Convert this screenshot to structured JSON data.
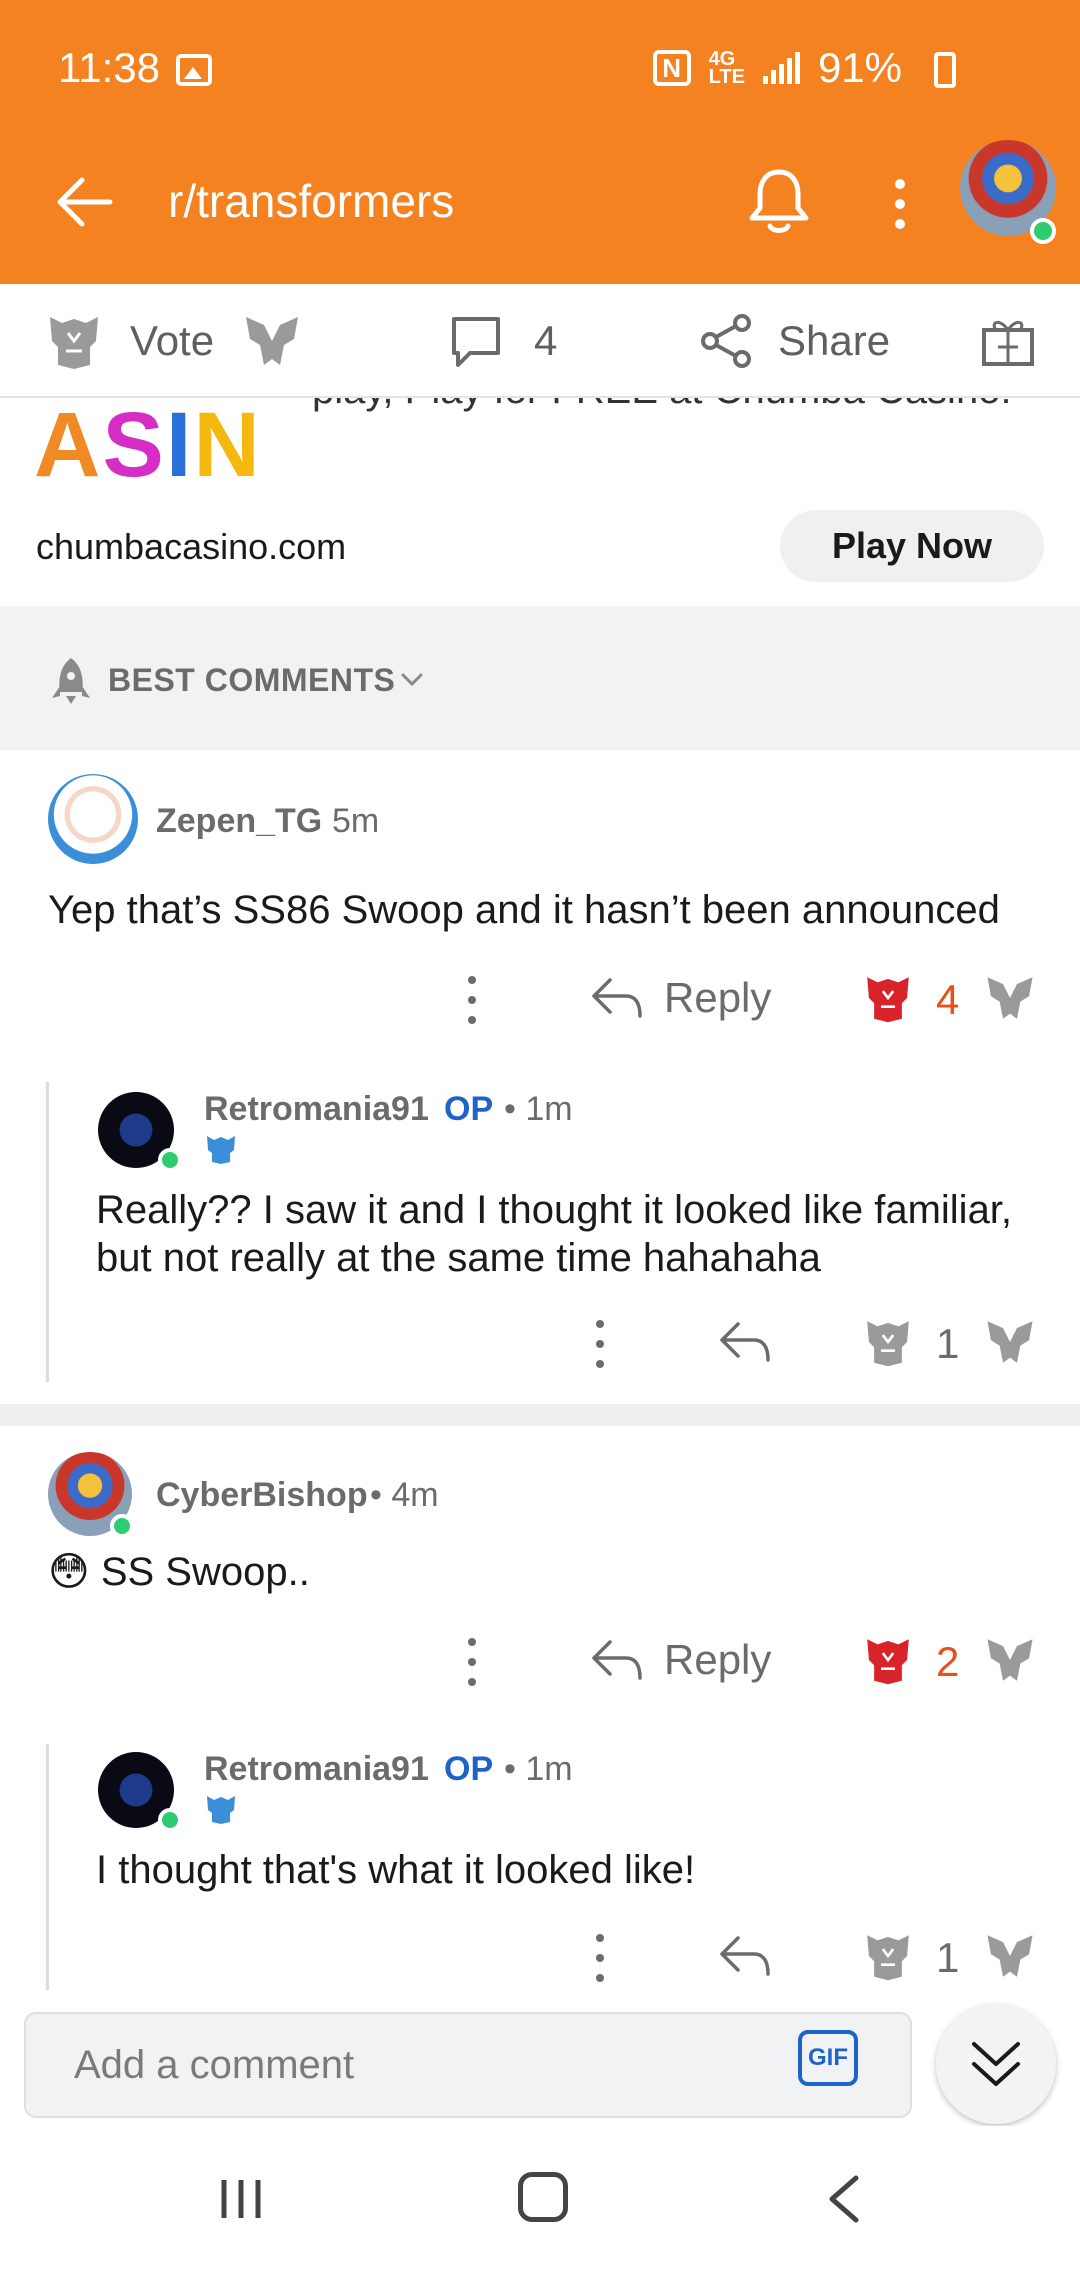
{
  "status_bar": {
    "time": "11:38",
    "network": "4G LTE",
    "battery": "91%"
  },
  "header": {
    "subreddit": "r/transformers",
    "icons": [
      "back-arrow-icon",
      "bell-icon",
      "more-vert-icon",
      "user-avatar"
    ]
  },
  "post_actions": {
    "vote_label": "Vote",
    "comment_count": "4",
    "share_label": "Share",
    "icons": [
      "autobot-upvote-icon",
      "decepticon-downvote-icon",
      "comment-bubble-icon",
      "share-icon",
      "award-gift-icon"
    ]
  },
  "ad": {
    "cut_text": "play, Play for FREE at Chumba Casino!",
    "logo_text": "ASIN",
    "domain": "chumbacasino.com",
    "cta": "Play Now"
  },
  "sort": {
    "label": "BEST COMMENTS"
  },
  "comments": [
    {
      "author": "Zepen_TG",
      "time": "5m",
      "text": "Yep that’s SS86 Swoop and it hasn’t been announced",
      "reply_label": "Reply",
      "score": "4",
      "replies": [
        {
          "author": "Retromania91",
          "op_label": "OP",
          "time": "• 1m",
          "text": "Really?? I saw it and I thought it looked like familiar, but not really at the same time hahahaha",
          "score": "1"
        }
      ]
    },
    {
      "author": "CyberBishop",
      "time": "• 4m",
      "text": "SS Swoop..",
      "emoji": "😳",
      "reply_label": "Reply",
      "score": "2",
      "replies": [
        {
          "author": "Retromania91",
          "op_label": "OP",
          "time": "• 1m",
          "text": "I thought that's what it looked like!",
          "score": "1"
        }
      ]
    }
  ],
  "composer": {
    "placeholder": "Add a comment",
    "gif_label": "GIF"
  },
  "colors": {
    "header_orange": "#f58220",
    "upvote_red": "#d8232a",
    "score_orange": "#e8501a",
    "op_blue": "#1e64c8",
    "online_green": "#2ecc71"
  }
}
